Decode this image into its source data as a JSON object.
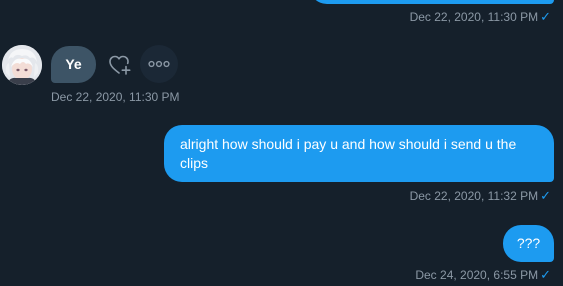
{
  "conversation": {
    "messages": [
      {
        "direction": "out",
        "text": "",
        "timestamp": "Dec 22, 2020, 11:30 PM",
        "status": "✓"
      },
      {
        "direction": "in",
        "text": "Ye",
        "timestamp": "Dec 22, 2020, 11:30 PM",
        "sender_avatar": "avatar"
      },
      {
        "direction": "out",
        "text": "alright how should i pay u and how should i send u the clips",
        "timestamp": "Dec 22, 2020, 11:32 PM",
        "status": "✓"
      },
      {
        "direction": "out",
        "text": "???",
        "timestamp": "Dec 24, 2020, 6:55 PM",
        "status": "✓"
      }
    ],
    "message_actions": {
      "react_icon": "heart-plus-icon",
      "more_icon": "more-options-icon"
    }
  },
  "colors": {
    "background": "#15202b",
    "outgoing_bubble": "#1d9bf0",
    "incoming_bubble": "#3d5466",
    "timestamp": "#8b98a5",
    "check": "#1d9bf0"
  }
}
